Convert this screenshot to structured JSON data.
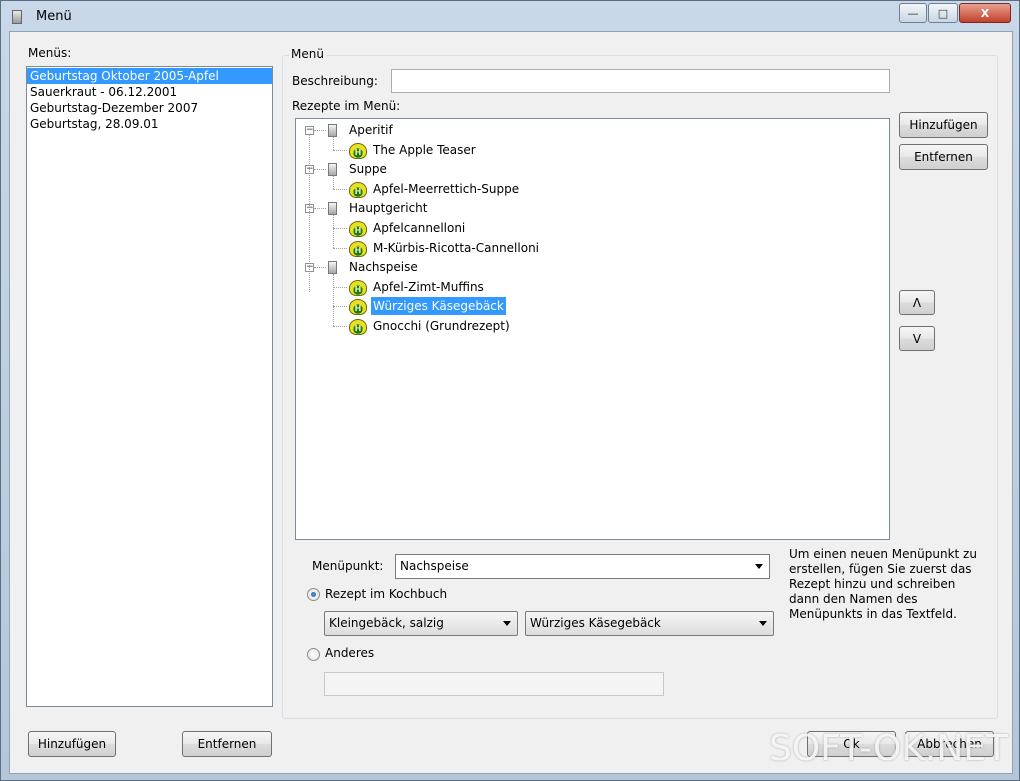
{
  "window": {
    "title": "Menü",
    "controls": {
      "minimize": "—",
      "maximize": "□",
      "close": "X"
    }
  },
  "left_panel": {
    "label": "Menüs:",
    "menus": [
      {
        "label": "Geburtstag Oktober 2005-Apfel",
        "selected": true
      },
      {
        "label": "Sauerkraut - 06.12.2001",
        "selected": false
      },
      {
        "label": "Geburtstag-Dezember 2007",
        "selected": false
      },
      {
        "label": "Geburtstag, 28.09.01",
        "selected": false
      }
    ],
    "add_label": "Hinzufügen",
    "remove_label": "Entfernen"
  },
  "menu_group": {
    "title": "Menü",
    "description_label": "Beschreibung:",
    "description_value": "",
    "recipes_label": "Rezepte im Menü:",
    "tree": [
      {
        "label": "Aperitif",
        "children": [
          "The Apple Teaser"
        ]
      },
      {
        "label": "Suppe",
        "children": [
          "Apfel-Meerrettich-Suppe"
        ]
      },
      {
        "label": "Hauptgericht",
        "children": [
          "Apfelcannelloni",
          "M-Kürbis-Ricotta-Cannelloni"
        ]
      },
      {
        "label": "Nachspeise",
        "children": [
          "Apfel-Zimt-Muffins",
          "Würziges Käsegebäck",
          "Gnocchi (Grundrezept)"
        ]
      }
    ],
    "selected_recipe": "Würziges Käsegebäck",
    "add_label": "Hinzufügen",
    "remove_label": "Entfernen",
    "up_label": "Λ",
    "down_label": "V",
    "icon_glyph": "H"
  },
  "item_editor": {
    "menu_item_label": "Menüpunkt:",
    "menu_item_value": "Nachspeise",
    "radio_cookbook_label": "Rezept im Kochbuch",
    "radio_cookbook_checked": true,
    "category_value": "Kleingebäck, salzig",
    "recipe_value": "Würziges Käsegebäck",
    "radio_other_label": "Anderes",
    "radio_other_checked": false,
    "other_value": "",
    "hint": "Um einen neuen Menüpunkt zu erstellen, fügen Sie zuerst das Rezept hinzu und schreiben dann den Namen des Menüpunkts in das Textfeld."
  },
  "footer": {
    "ok_label": "Ok",
    "cancel_label": "Abbrechen"
  },
  "watermark": "SOFT-OK.NET"
}
